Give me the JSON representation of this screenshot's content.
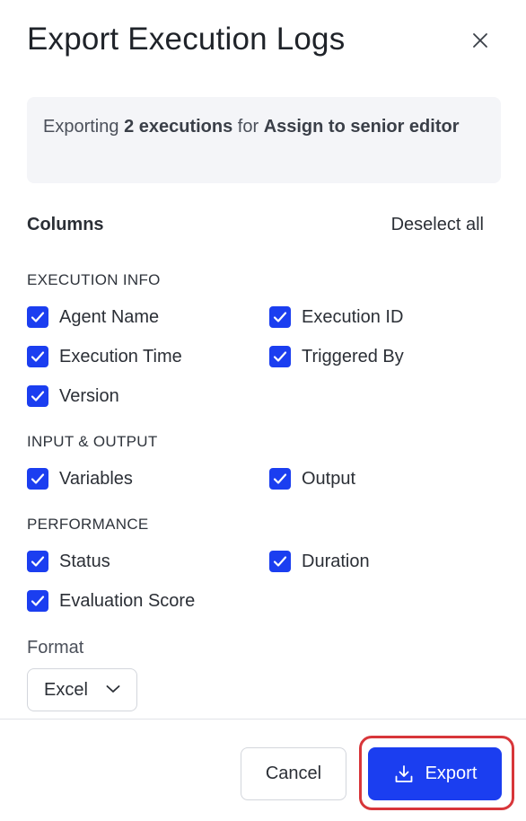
{
  "dialog": {
    "title": "Export Execution Logs",
    "close_icon": "close-icon"
  },
  "info": {
    "prefix": "Exporting ",
    "count_text": "2 executions",
    "middle": " for ",
    "target": "Assign to senior editor"
  },
  "columns": {
    "heading": "Columns",
    "deselect_all": "Deselect all"
  },
  "sections": [
    {
      "title": "EXECUTION INFO",
      "items": [
        {
          "label": "Agent Name",
          "checked": true
        },
        {
          "label": "Execution ID",
          "checked": true
        },
        {
          "label": "Execution Time",
          "checked": true
        },
        {
          "label": "Triggered By",
          "checked": true
        },
        {
          "label": "Version",
          "checked": true
        }
      ]
    },
    {
      "title": "INPUT & OUTPUT",
      "items": [
        {
          "label": "Variables",
          "checked": true
        },
        {
          "label": "Output",
          "checked": true
        }
      ]
    },
    {
      "title": "PERFORMANCE",
      "items": [
        {
          "label": "Status",
          "checked": true
        },
        {
          "label": "Duration",
          "checked": true
        },
        {
          "label": "Evaluation Score",
          "checked": true
        }
      ]
    }
  ],
  "format": {
    "label": "Format",
    "selected": "Excel"
  },
  "footer": {
    "cancel_label": "Cancel",
    "export_label": "Export",
    "export_icon": "download-icon"
  },
  "colors": {
    "accent": "#1b3ef0",
    "highlight": "#d8363a"
  }
}
